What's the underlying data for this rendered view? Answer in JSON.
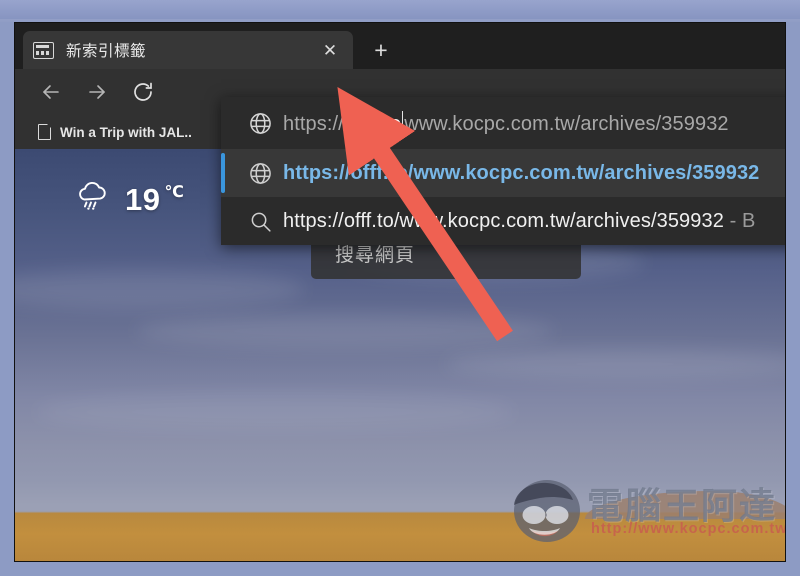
{
  "window": {
    "tab": {
      "title": "新索引標籤",
      "favicon_icon": "new-tab-page-icon",
      "close_icon": "close-icon"
    },
    "new_tab_button_icon": "plus-icon",
    "toolbar": {
      "back_icon": "arrow-left-icon",
      "forward_icon": "arrow-right-icon",
      "reload_icon": "reload-icon"
    },
    "bookmarks": [
      {
        "label": "Win a Trip with JAL..",
        "icon": "page-icon"
      }
    ]
  },
  "omnibox": {
    "typed_prefix": "https://",
    "typed_highlight": "offf.to",
    "typed_suffix": "www.kocpc.com.tw/archives/359932",
    "icon": "globe-icon",
    "suggestions": [
      {
        "icon": "globe-icon",
        "text": "https://offf.to/www.kocpc.com.tw/archives/359932",
        "kind": "url",
        "selected": true
      },
      {
        "icon": "search-icon",
        "text": "https://offf.to/www.kocpc.com.tw/archives/359932",
        "suffix": " - B",
        "kind": "search",
        "selected": false
      }
    ]
  },
  "new_tab_page": {
    "weather": {
      "icon": "rain-cloud-icon",
      "temperature": "19",
      "unit": "℃"
    },
    "search_placeholder": "搜尋網頁"
  },
  "annotation": {
    "arrow_color": "#ef6152",
    "arrow_points_at": "offf.to"
  },
  "watermark": {
    "brand": "電腦王阿達",
    "url": "http://www.kocpc.com.tw"
  },
  "colors": {
    "accent_blue": "#3a96dd",
    "link_blue": "#79b8e8",
    "chrome_dark": "#313131",
    "dropdown_bg": "#2b2b2b",
    "arrow_red": "#ef6152"
  }
}
